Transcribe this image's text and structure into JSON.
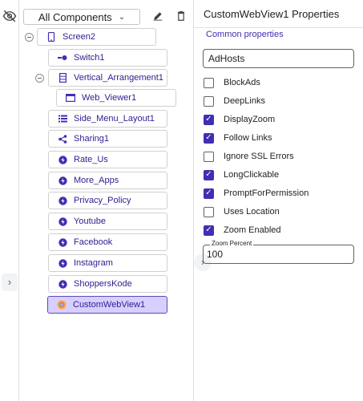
{
  "toolbar": {
    "dropdown_label": "All Components"
  },
  "tree": {
    "screen": "Screen2",
    "switch": "Switch1",
    "arrangement": "Vertical_Arrangement1",
    "webviewer": "Web_Viewer1",
    "items": [
      {
        "label": "Side_Menu_Layout1",
        "icon": "menu-layout-icon"
      },
      {
        "label": "Sharing1",
        "icon": "share-icon"
      },
      {
        "label": "Rate_Us",
        "icon": "extension-icon"
      },
      {
        "label": "More_Apps",
        "icon": "extension-icon"
      },
      {
        "label": "Privacy_Policy",
        "icon": "extension-icon"
      },
      {
        "label": "Youtube",
        "icon": "extension-icon"
      },
      {
        "label": "Facebook",
        "icon": "extension-icon"
      },
      {
        "label": "Instagram",
        "icon": "extension-icon"
      },
      {
        "label": "ShoppersKode",
        "icon": "extension-icon"
      }
    ],
    "selected": "CustomWebView1"
  },
  "properties": {
    "title": "CustomWebView1 Properties",
    "section": "Common properties",
    "adhosts_value": "AdHosts",
    "checkboxes": [
      {
        "label": "BlockAds",
        "checked": false
      },
      {
        "label": "DeepLinks",
        "checked": false
      },
      {
        "label": "DisplayZoom",
        "checked": true
      },
      {
        "label": "Follow Links",
        "checked": true
      },
      {
        "label": "Ignore SSL Errors",
        "checked": false
      },
      {
        "label": "LongClickable",
        "checked": true
      },
      {
        "label": "PromptForPermission",
        "checked": true
      },
      {
        "label": "Uses Location",
        "checked": false
      },
      {
        "label": "Zoom Enabled",
        "checked": true
      }
    ],
    "zoom_label": "Zoom Percent",
    "zoom_value": "100"
  },
  "colors": {
    "accent": "#3f2fb2",
    "selected_bg": "#d7cffd"
  }
}
